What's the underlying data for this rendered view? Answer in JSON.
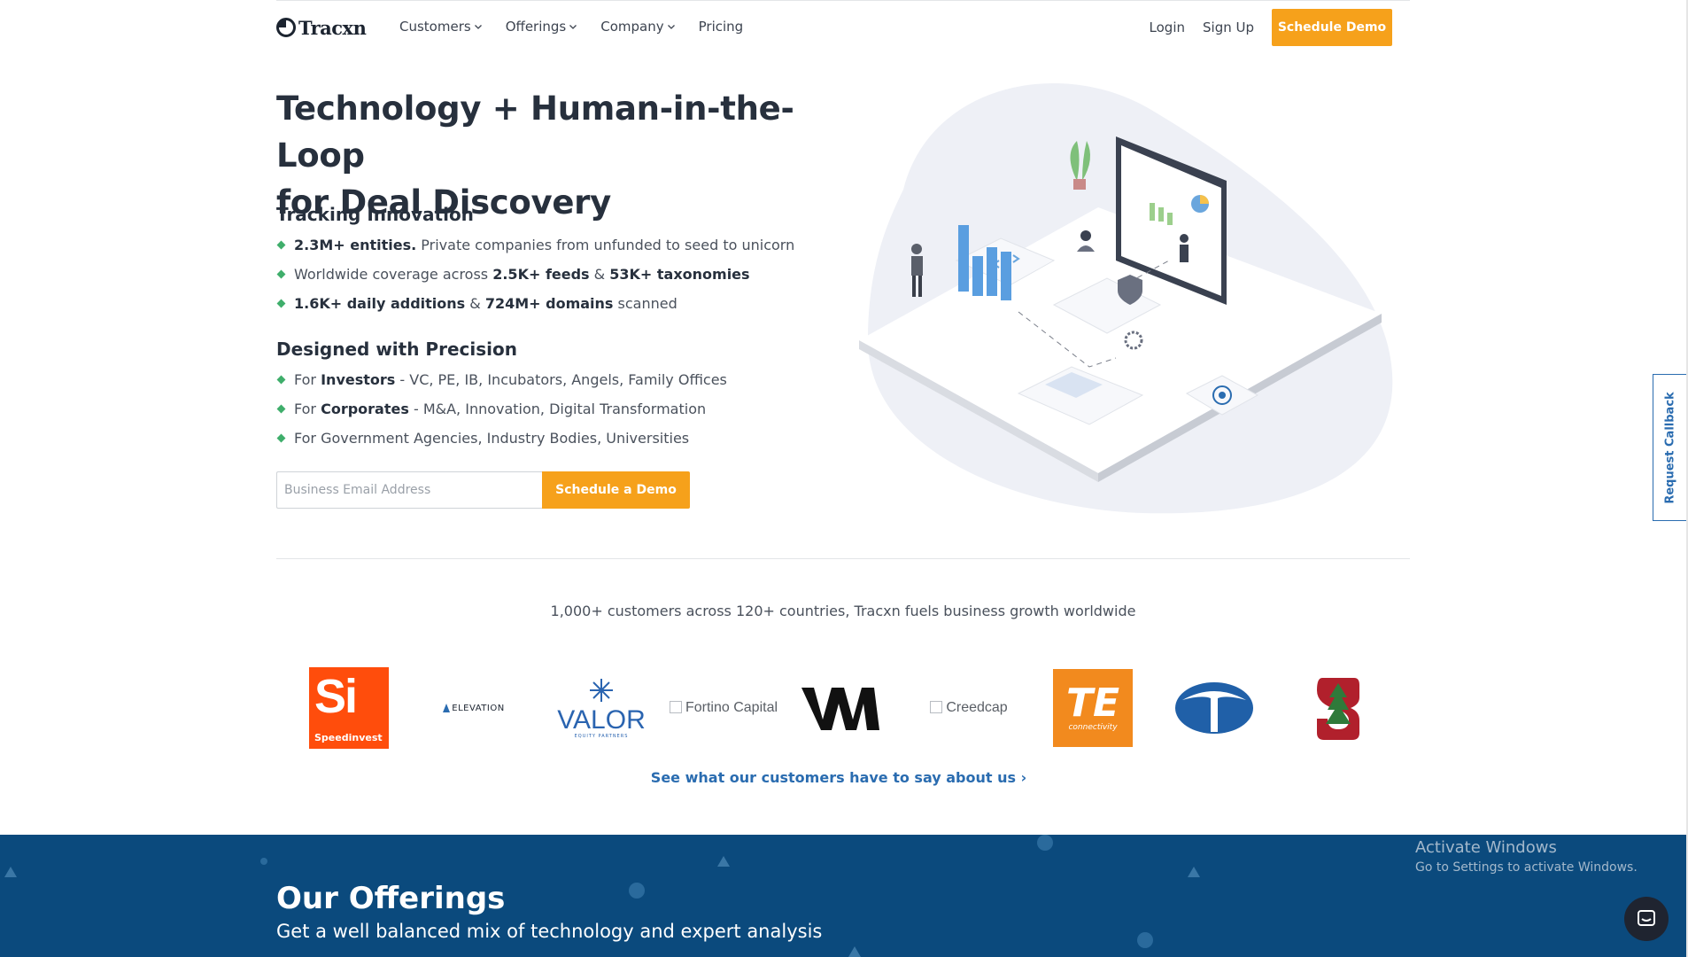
{
  "nav": {
    "brand": "Tracxn",
    "items": [
      {
        "label": "Customers",
        "dropdown": true
      },
      {
        "label": "Offerings",
        "dropdown": true
      },
      {
        "label": "Company",
        "dropdown": true
      },
      {
        "label": "Pricing",
        "dropdown": false
      }
    ],
    "login": "Login",
    "signup": "Sign Up",
    "cta": "Schedule Demo"
  },
  "hero": {
    "title_line1": "Technology + Human-in-the-Loop",
    "title_line2": "for Deal Discovery",
    "tracking": {
      "heading": "Tracking Innovation",
      "b1_bold": "2.3M+ entities.",
      "b1_rest": " Private companies from unfunded to seed to unicorn",
      "b2_pre": "Worldwide coverage across ",
      "b2_bold1": "2.5K+ feeds",
      "b2_mid": " & ",
      "b2_bold2": "53K+ taxonomies",
      "b3_bold1": "1.6K+ daily additions",
      "b3_mid": " & ",
      "b3_bold2": "724M+ domains",
      "b3_rest": " scanned"
    },
    "precision": {
      "heading": "Designed with Precision",
      "b1_pre": "For ",
      "b1_bold": "Investors",
      "b1_rest": " - VC, PE, IB, Incubators, Angels, Family Offices",
      "b2_pre": "For ",
      "b2_bold": "Corporates",
      "b2_rest": " - M&A, Innovation, Digital Transformation",
      "b3": "For Government Agencies, Industry Bodies, Universities"
    },
    "email_placeholder": "Business Email Address",
    "email_cta": "Schedule a Demo"
  },
  "customers": {
    "headline": "1,000+ customers across 120+ countries, Tracxn fuels business growth worldwide",
    "logos": {
      "speedinvest_mark": "Si",
      "speedinvest_name": "Speedinvest",
      "elevation": "ELEVATION",
      "valor": "VALOR",
      "valor_sub": "EQUITY PARTNERS",
      "fortino_alt": "Fortino Capital",
      "creedcap_alt": "Creedcap",
      "te_mark": "TE",
      "te_sub": "connectivity"
    },
    "see_more": "See what our customers have to say about us"
  },
  "offerings": {
    "title": "Our Offerings",
    "subtitle": "Get a well balanced mix of technology and expert analysis"
  },
  "callback_tab": "Request Callback",
  "windows_watermark": {
    "line1": "Activate Windows",
    "line2": "Go to Settings to activate Windows."
  },
  "colors": {
    "accent_orange": "#f6a11b",
    "link_blue": "#2a6cb0",
    "offerings_bg": "#0b4a7d",
    "bullet_green": "#3fae6b"
  }
}
